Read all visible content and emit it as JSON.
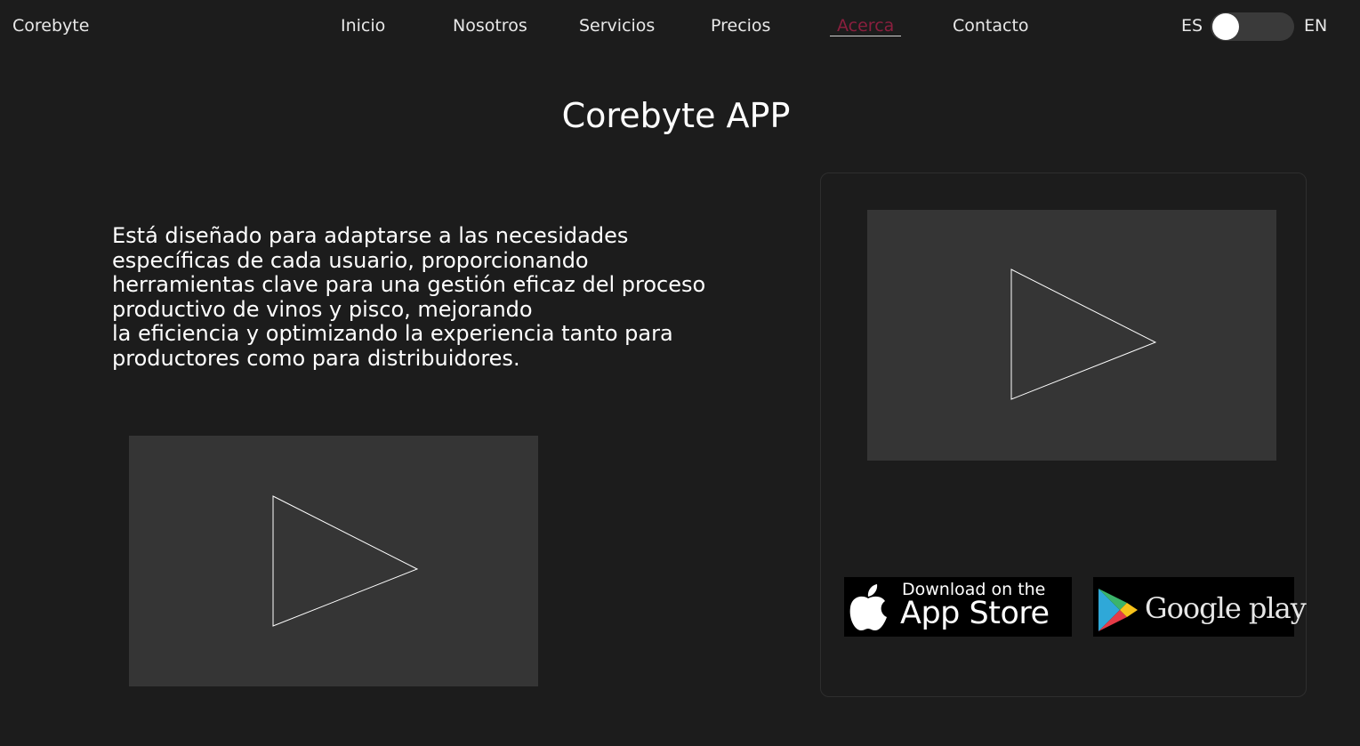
{
  "header": {
    "brand": "Corebyte",
    "nav": [
      "Inicio",
      "Nosotros",
      "Servicios",
      "Precios",
      "Acerca",
      "Contacto"
    ],
    "active_nav": "Acerca",
    "lang_left": "ES",
    "lang_right": "EN"
  },
  "main": {
    "title": "Corebyte APP",
    "description_lines": [
      "Está diseñado para adaptarse a las necesidades",
      "específicas de cada usuario, proporcionando",
      "herramientas clave para una gestión eficaz del proceso",
      "productivo de vinos y pisco, mejorando",
      "la eficiencia y optimizando la experiencia tanto para",
      "productores como para distribuidores."
    ]
  },
  "badges": {
    "apple_small": "Download on the",
    "apple_big": "App Store",
    "google": "Google play"
  },
  "icons": {
    "play": "play-icon",
    "apple": "apple-icon",
    "google_play": "google-play-icon"
  },
  "colors": {
    "background": "#1c1c1c",
    "active_nav": "#8a1f3e",
    "video_placeholder": "#353535"
  }
}
